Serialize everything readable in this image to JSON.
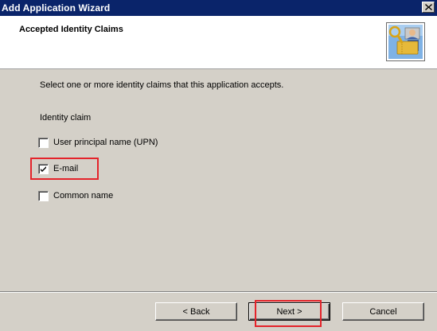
{
  "window": {
    "title": "Add Application Wizard"
  },
  "header": {
    "title": "Accepted Identity Claims",
    "icon": "wizard-ticket-user-icon"
  },
  "content": {
    "intro": "Select one or more identity claims that this application accepts.",
    "section_label": "Identity claim",
    "claims": [
      {
        "label": "User principal name (UPN)",
        "checked": false
      },
      {
        "label": "E-mail",
        "checked": true
      },
      {
        "label": "Common name",
        "checked": false
      }
    ]
  },
  "buttons": {
    "back": "< Back",
    "next": "Next >",
    "cancel": "Cancel"
  },
  "colors": {
    "titlebar": "#0a246a",
    "face": "#d4d0c8",
    "highlight": "#e4232a"
  }
}
